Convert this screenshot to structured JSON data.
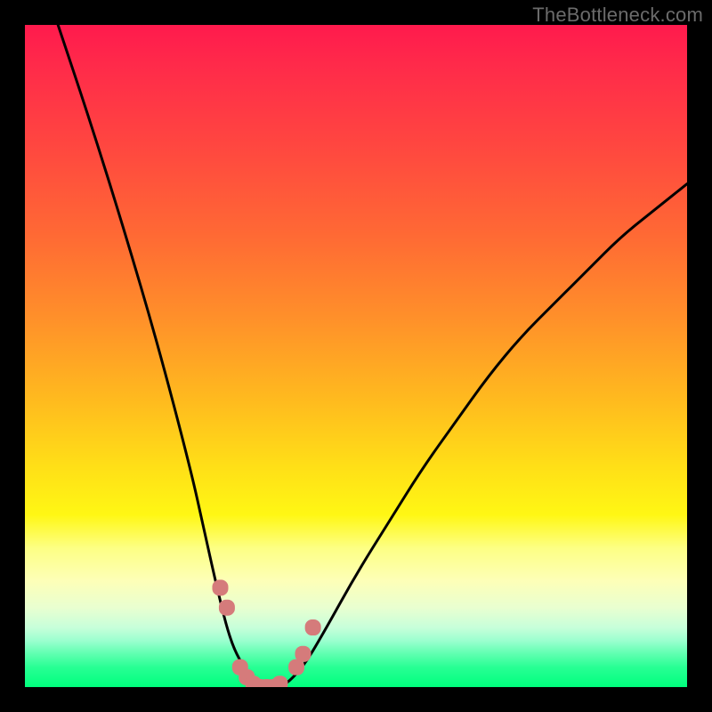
{
  "attribution": "TheBottleneck.com",
  "chart_data": {
    "type": "line",
    "title": "",
    "xlabel": "",
    "ylabel": "",
    "xlim": [
      0,
      100
    ],
    "ylim": [
      0,
      100
    ],
    "grid": false,
    "legend": false,
    "series": [
      {
        "name": "bottleneck-curve",
        "x": [
          5,
          10,
          15,
          20,
          25,
          27,
          29,
          31,
          33,
          35,
          37,
          39,
          42,
          45,
          50,
          55,
          60,
          65,
          70,
          75,
          80,
          85,
          90,
          95,
          100
        ],
        "y": [
          100,
          85,
          69,
          52,
          33,
          24,
          15,
          7,
          3,
          0,
          0,
          0,
          3,
          8,
          17,
          25,
          33,
          40,
          47,
          53,
          58,
          63,
          68,
          72,
          76
        ]
      }
    ],
    "markers": {
      "name": "highlight-points",
      "color": "#d57b7b",
      "x": [
        29.5,
        30.5,
        32.5,
        33.5,
        34.5,
        35.5,
        36.5,
        37.5,
        38.5,
        41.0,
        42.0,
        43.5
      ],
      "y": [
        15,
        12,
        3,
        1.5,
        0.5,
        0,
        0,
        0,
        0.5,
        3,
        5,
        9
      ]
    },
    "background": {
      "type": "vertical-gradient",
      "stops": [
        {
          "pos": 0,
          "color": "#ff1a4d"
        },
        {
          "pos": 32,
          "color": "#ff6a34"
        },
        {
          "pos": 67,
          "color": "#ffe017"
        },
        {
          "pos": 84,
          "color": "#fdffb8"
        },
        {
          "pos": 100,
          "color": "#00ff7d"
        }
      ]
    }
  }
}
